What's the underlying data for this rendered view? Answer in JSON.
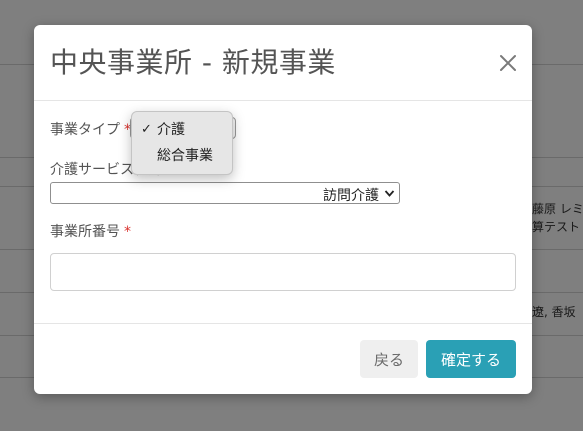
{
  "background": {
    "row1_text": "藤原 レミ",
    "row2_text": "算テスト",
    "row3_text": "遼, 香坂"
  },
  "modal": {
    "title": "中央事業所 - 新規事業",
    "fields": {
      "business_type_label": "事業タイプ",
      "service_type_label": "介護サービス種別",
      "service_type_value": "訪問介護",
      "office_number_label": "事業所番号",
      "office_number_value": "",
      "required_mark": "*"
    },
    "dropdown": {
      "options": [
        {
          "label": "介護",
          "selected": true,
          "check": "✓"
        },
        {
          "label": "総合事業",
          "selected": false
        }
      ]
    },
    "footer": {
      "back_label": "戻る",
      "confirm_label": "確定する"
    }
  },
  "colors": {
    "primary": "#2aa0b5",
    "secondary": "#efefef",
    "required": "#d9302c",
    "title": "#545454"
  }
}
